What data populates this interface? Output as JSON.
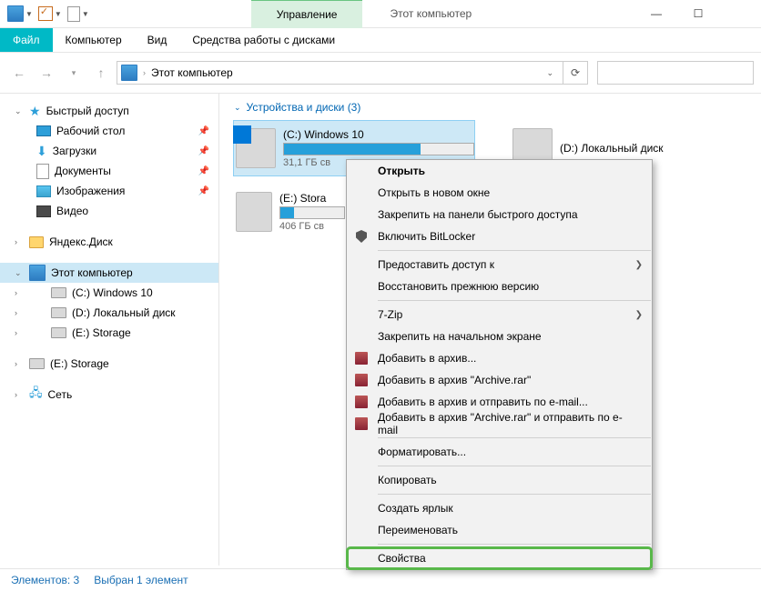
{
  "titlebar": {
    "context_tab": "Управление",
    "title": "Этот компьютер"
  },
  "ribbon_tabs": {
    "file": "Файл",
    "computer": "Компьютер",
    "view": "Вид",
    "drive_tools": "Средства работы с дисками"
  },
  "address": {
    "location": "Этот компьютер"
  },
  "nav": {
    "quick_access": "Быстрый доступ",
    "desktop": "Рабочий стол",
    "downloads": "Загрузки",
    "documents": "Документы",
    "pictures": "Изображения",
    "videos": "Видео",
    "yandex": "Яндекс.Диск",
    "this_pc": "Этот компьютер",
    "drive_c": "(C:) Windows 10",
    "drive_d": "(D:) Локальный диск",
    "drive_e": "(E:) Storage",
    "drive_e2": "(E:) Storage",
    "network": "Сеть"
  },
  "group_header": "Устройства и диски (3)",
  "drives": {
    "c": {
      "name": "(C:) Windows 10",
      "free": "31,1 ГБ св"
    },
    "d": {
      "name": "(D:) Локальный диск"
    },
    "e": {
      "name": "(E:) Stora",
      "free": "406 ГБ св"
    }
  },
  "context_menu": {
    "open": "Открыть",
    "open_new": "Открыть в новом окне",
    "pin_qa": "Закрепить на панели быстрого доступа",
    "bitlocker": "Включить BitLocker",
    "share": "Предоставить доступ к",
    "restore": "Восстановить прежнюю версию",
    "sevenzip": "7-Zip",
    "pin_start": "Закрепить на начальном экране",
    "rar_add": "Добавить в архив...",
    "rar_archive": "Добавить в архив \"Archive.rar\"",
    "rar_email": "Добавить в архив и отправить по e-mail...",
    "rar_archive_email": "Добавить в архив \"Archive.rar\" и отправить по e-mail",
    "format": "Форматировать...",
    "copy": "Копировать",
    "shortcut": "Создать ярлык",
    "rename": "Переименовать",
    "properties": "Свойства"
  },
  "status": {
    "items": "Элементов: 3",
    "selected": "Выбран 1 элемент"
  }
}
